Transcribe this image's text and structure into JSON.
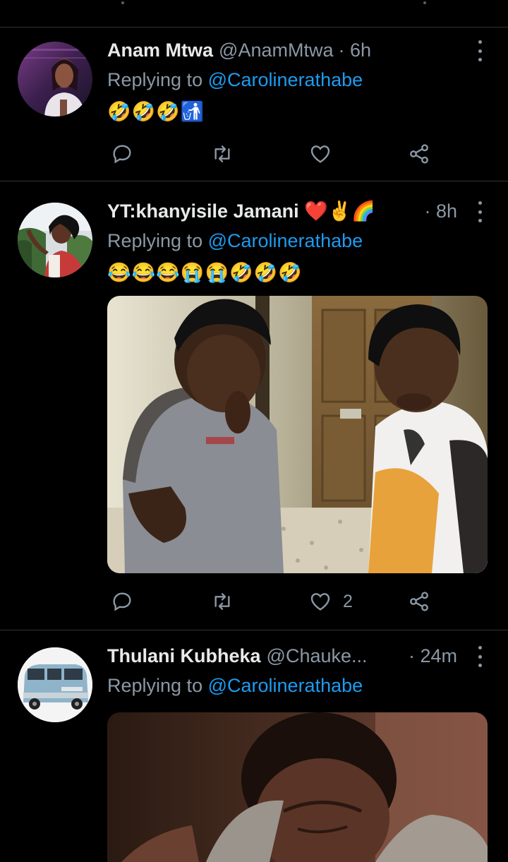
{
  "tweets": [
    {
      "name": "Anam Mtwa",
      "handle": "@AnamMtwa",
      "time": "· 6h",
      "replying_prefix": "Replying to",
      "replying_to": "@Carolinerathabe",
      "emojis": "🤣🤣🤣🚮",
      "like_count": ""
    },
    {
      "name": "YT:khanyisile Jamani ❤️✌️🌈",
      "handle": "",
      "time": "· 8h",
      "replying_prefix": "Replying to",
      "replying_to": "@Carolinerathabe",
      "emojis": "😂😂😂😭😭🤣🤣🤣",
      "like_count": "2"
    },
    {
      "name": "Thulani Kubheka",
      "handle": "@Chauke...",
      "time": "· 24m",
      "replying_prefix": "Replying to",
      "replying_to": "@Carolinerathabe"
    }
  ],
  "colors": {
    "background": "#000000",
    "text": "#e7e9ea",
    "muted": "#8b98a5",
    "link": "#1d9bf0",
    "divider": "#2f3336"
  },
  "icons": [
    "reply-icon",
    "retweet-icon",
    "like-icon",
    "share-icon",
    "more-icon"
  ]
}
